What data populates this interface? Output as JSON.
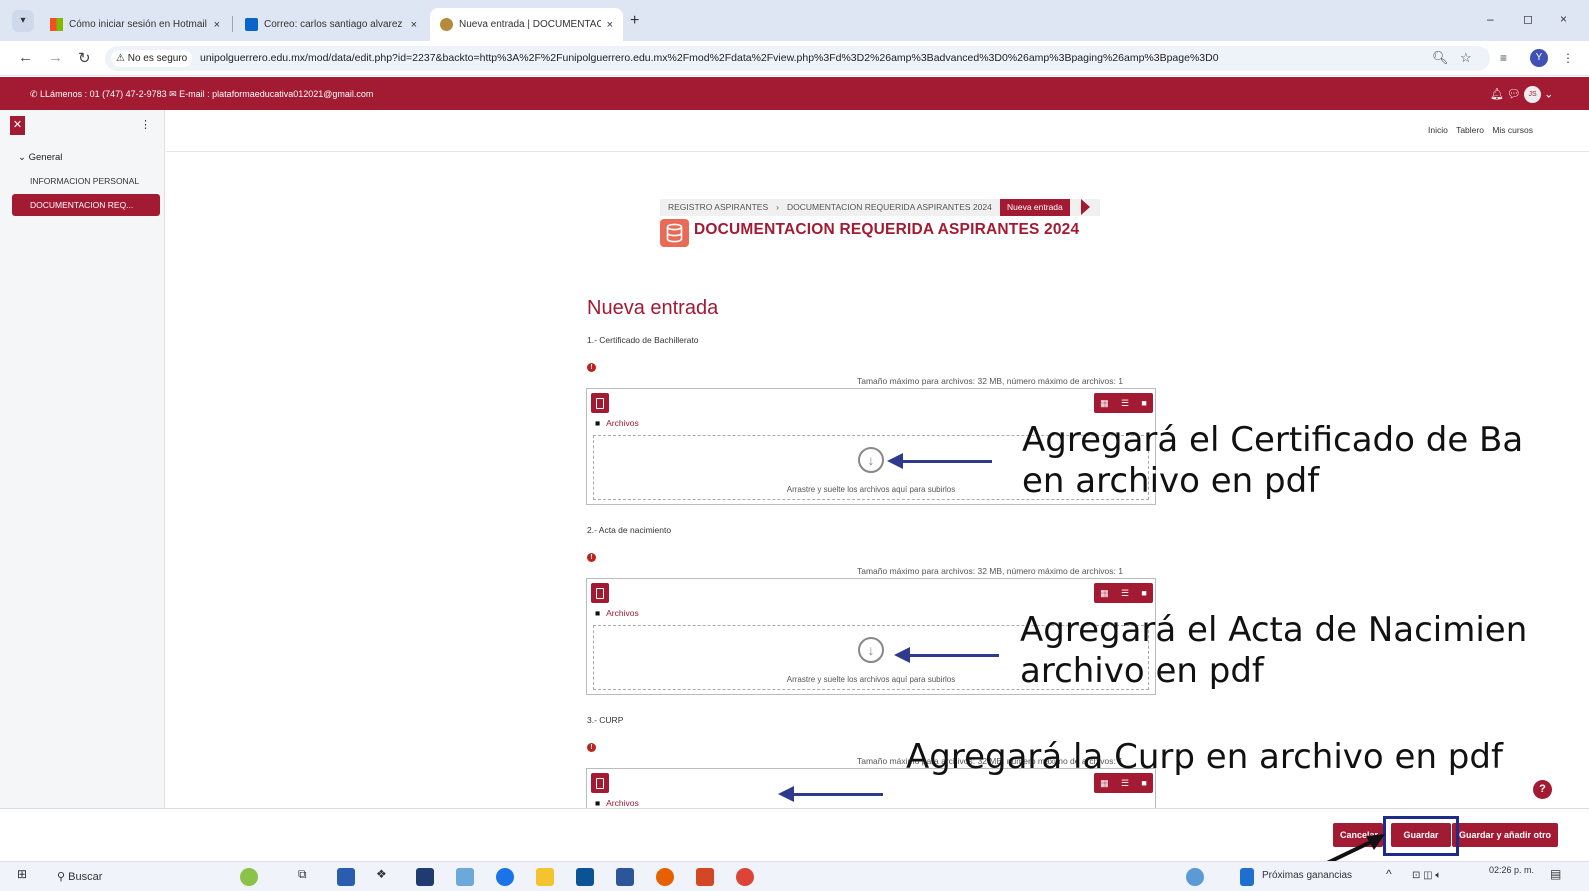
{
  "browser": {
    "tabs": [
      {
        "label": "Cómo iniciar sesión en Hotmail",
        "close": "×"
      },
      {
        "label": "Correo: carlos santiago alvarez",
        "close": "×"
      },
      {
        "label": "Nueva entrada | DOCUMENTAC",
        "close": "×"
      }
    ],
    "new_tab": "+",
    "window_controls": {
      "min": "–",
      "max": "◻",
      "close": "×"
    },
    "security": "No es seguro",
    "url": "unipolguerrero.edu.mx/mod/data/edit.php?id=2237&backto=http%3A%2F%2Funipolguerrero.edu.mx%2Fmod%2Fdata%2Fview.php%3Fd%3D2%26amp%3Badvanced%3D0%26amp%3Bpaging%26amp%3Bpage%3D0",
    "profile_initial": "Y"
  },
  "site": {
    "contact": "LLámenos : 01 (747) 47-2-9783  ✉ E-mail : plataformaeducativa012021@gmail.com",
    "user_initials": "JS",
    "top_nav": [
      "Inicio",
      "Tablero",
      "Mis cursos"
    ]
  },
  "drawer": {
    "section": "General",
    "items": [
      {
        "label": "INFORMACION PERSONAL",
        "active": false
      },
      {
        "label": "DOCUMENTACION REQ...",
        "active": true
      }
    ]
  },
  "breadcrumb": {
    "items": [
      "REGISTRO ASPIRANTES",
      "DOCUMENTACION REQUERIDA ASPIRANTES 2024"
    ],
    "separator": "›",
    "current": "Nueva entrada"
  },
  "page": {
    "db_title": "DOCUMENTACION REQUERIDA ASPIRANTES 2024",
    "form_title": "Nueva entrada"
  },
  "fields": [
    {
      "label": "1.- Certificado de Bachillerato",
      "max_info": "Tamaño máximo para archivos: 32 MB, número máximo de archivos: 1",
      "path": "Archivos",
      "drop_text": "Arrastre y suelte los archivos aquí para subirlos"
    },
    {
      "label": "2.- Acta de nacimiento",
      "max_info": "Tamaño máximo para archivos: 32 MB, número máximo de archivos: 1",
      "path": "Archivos",
      "drop_text": "Arrastre y suelte los archivos aquí para subirlos"
    },
    {
      "label": "3.- CURP",
      "max_info": "Tamaño máximo para archivos: 32 MB, número máximo de archivos: 1",
      "path": "Archivos",
      "drop_text": ""
    }
  ],
  "annotations": {
    "a1_line1": "Agregará el Certificado de Ba",
    "a1_line2": "en archivo en pdf",
    "a2_line1": "Agregará el Acta de Nacimien",
    "a2_line2": "archivo en pdf",
    "a3": "Agregará la Curp en archivo en pdf"
  },
  "buttons": {
    "cancel": "Cancelar",
    "save": "Guardar",
    "save_add": "Guardar y añadir otro",
    "help": "?"
  },
  "taskbar": {
    "search": "Buscar",
    "widget": "Próximas ganancias",
    "time": "02:26 p. m."
  },
  "colors": {
    "brand": "#a31a33",
    "annotation_arrow": "#2e3a8c"
  }
}
